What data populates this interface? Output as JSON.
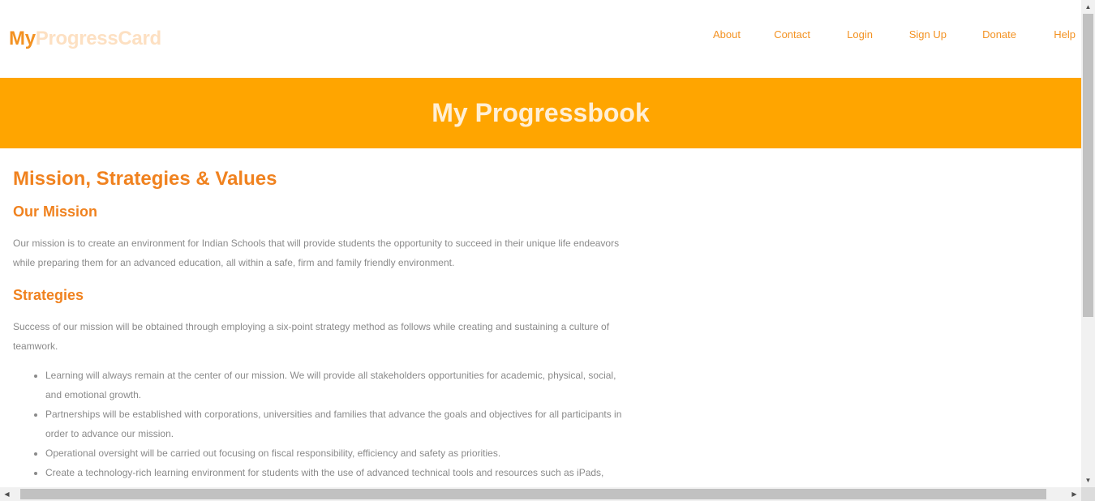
{
  "header": {
    "logo_part1": "My",
    "logo_part2": "ProgressCard",
    "nav": [
      "About",
      "Contact",
      "Login",
      "Sign Up",
      "Donate",
      "Help"
    ]
  },
  "banner": {
    "title": "My Progressbook"
  },
  "main": {
    "title": "Mission, Strategies & Values",
    "mission": {
      "heading": "Our Mission",
      "line1": "Our mission is to create an environment for Indian Schools that will provide students the opportunity to succeed in their unique life endeavors",
      "line2": "while preparing them for an advanced education, all within a safe, firm and family friendly environment."
    },
    "strategies": {
      "heading": "Strategies",
      "intro_line1": "Success of our mission will be obtained through employing a six-point strategy method as follows while creating and sustaining a culture of",
      "intro_line2": "teamwork.",
      "items": [
        {
          "line1": "Learning will always remain at the center of our mission. We will provide all stakeholders opportunities for academic, physical, social,",
          "line2": "and emotional growth."
        },
        {
          "line1": "Partnerships will be established with corporations, universities and families that advance the goals and objectives for all participants in",
          "line2": "order to advance our mission."
        },
        {
          "line1": "Operational oversight will be carried out focusing on fiscal responsibility, efficiency and safety as priorities.",
          "line2": ""
        },
        {
          "line1": "Create a technology-rich learning environment for students with the use of advanced technical tools and resources such as iPads,",
          "line2": ""
        }
      ]
    }
  },
  "colors": {
    "accent": "#f39222",
    "banner_bg": "#ffa500",
    "text": "#8a8a8a"
  }
}
